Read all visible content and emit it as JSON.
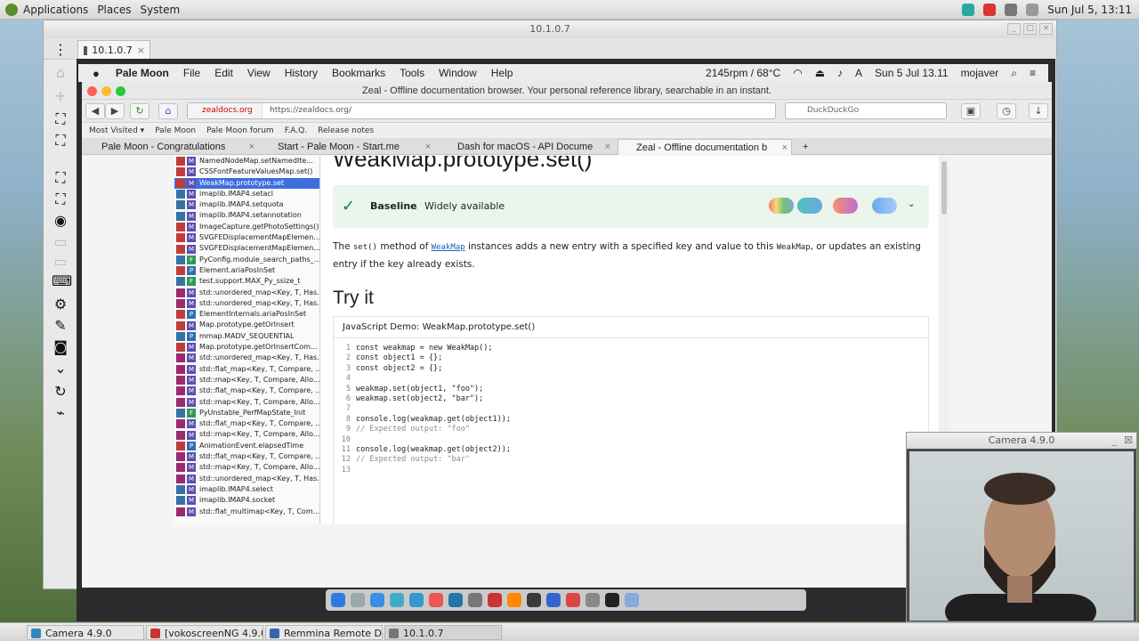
{
  "topbar": {
    "menus": [
      "Applications",
      "Places",
      "System"
    ],
    "clock": "Sun Jul  5, 13:11"
  },
  "remote_window": {
    "title": "10.1.0.7",
    "tab_label": "10.1.0.7"
  },
  "macbar": {
    "app_name": "Pale Moon",
    "menus": [
      "File",
      "Edit",
      "View",
      "History",
      "Bookmarks",
      "Tools",
      "Window",
      "Help"
    ],
    "fan": "2145rpm / 68°C",
    "datetime": "Sun 5 Jul  13.11",
    "user": "mojaver"
  },
  "browser": {
    "window_title": "Zeal - Offline documentation browser. Your personal reference library, searchable in an instant.",
    "site_label": "zealdocs.org",
    "url": "https://zealdocs.org/",
    "search_placeholder": "DuckDuckGo",
    "bookmarks": [
      "Most Visited ▾",
      "Pale Moon",
      "Pale Moon forum",
      "F.A.Q.",
      "Release notes"
    ],
    "tabs": [
      {
        "label": "Pale Moon - Congratulations"
      },
      {
        "label": "Start - Pale Moon - Start.me"
      },
      {
        "label": "Dash for macOS - API Docume"
      },
      {
        "label": "Zeal - Offline documentation b"
      }
    ],
    "new_tab": "+"
  },
  "sidebar": {
    "items": [
      {
        "label": "NamedNodeMap.setNamedIte...",
        "type": "M",
        "lang": "JS"
      },
      {
        "label": "CSSFontFeatureValuesMap.set()",
        "type": "M",
        "lang": "JS"
      },
      {
        "label": "WeakMap.prototype.set",
        "type": "M",
        "lang": "JS"
      },
      {
        "label": "imaplib.IMAP4.setacl",
        "type": "M",
        "lang": "PY"
      },
      {
        "label": "imaplib.IMAP4.setquota",
        "type": "M",
        "lang": "PY"
      },
      {
        "label": "imaplib.IMAP4.setannotation",
        "type": "M",
        "lang": "PY"
      },
      {
        "label": "ImageCapture.getPhotoSettings()",
        "type": "M",
        "lang": "JS"
      },
      {
        "label": "SVGFEDisplacementMapElemen...",
        "type": "M",
        "lang": "JS"
      },
      {
        "label": "SVGFEDisplacementMapElemen...",
        "type": "M",
        "lang": "JS"
      },
      {
        "label": "PyConfig.module_search_paths_...",
        "type": "F",
        "lang": "PY"
      },
      {
        "label": "Element.ariaPosInSet",
        "type": "P",
        "lang": "JS"
      },
      {
        "label": "test.support.MAX_Py_ssize_t",
        "type": "F",
        "lang": "PY"
      },
      {
        "label": "std::unordered_map<Key, T, Has...",
        "type": "M",
        "lang": "C"
      },
      {
        "label": "std::unordered_map<Key, T, Has...",
        "type": "M",
        "lang": "C"
      },
      {
        "label": "ElementInternals.ariaPosInSet",
        "type": "P",
        "lang": "JS"
      },
      {
        "label": "Map.prototype.getOrInsert",
        "type": "M",
        "lang": "JS"
      },
      {
        "label": "mmap.MADV_SEQUENTIAL",
        "type": "P",
        "lang": "PY"
      },
      {
        "label": "Map.prototype.getOrInsertCom...",
        "type": "M",
        "lang": "JS"
      },
      {
        "label": "std::unordered_map<Key, T, Has...",
        "type": "M",
        "lang": "C"
      },
      {
        "label": "std::flat_map<Key, T, Compare, ...",
        "type": "M",
        "lang": "C"
      },
      {
        "label": "std::map<Key, T, Compare, Allo...",
        "type": "M",
        "lang": "C"
      },
      {
        "label": "std::flat_map<Key, T, Compare, ...",
        "type": "M",
        "lang": "C"
      },
      {
        "label": "std::map<Key, T, Compare, Allo...",
        "type": "M",
        "lang": "C"
      },
      {
        "label": "PyUnstable_PerfMapState_Init",
        "type": "F",
        "lang": "PY"
      },
      {
        "label": "std::flat_map<Key, T, Compare, ...",
        "type": "M",
        "lang": "C"
      },
      {
        "label": "std::map<Key, T, Compare, Allo...",
        "type": "M",
        "lang": "C"
      },
      {
        "label": "AnimationEvent.elapsedTime",
        "type": "P",
        "lang": "JS"
      },
      {
        "label": "std::flat_map<Key, T, Compare, ...",
        "type": "M",
        "lang": "C"
      },
      {
        "label": "std::map<Key, T, Compare, Allo...",
        "type": "M",
        "lang": "C"
      },
      {
        "label": "std::unordered_map<Key, T, Has...",
        "type": "M",
        "lang": "C"
      },
      {
        "label": "imaplib.IMAP4.select",
        "type": "M",
        "lang": "PY"
      },
      {
        "label": "imaplib.IMAP4.socket",
        "type": "M",
        "lang": "PY"
      },
      {
        "label": "std::flat_multimap<Key, T, Com...",
        "type": "M",
        "lang": "C"
      }
    ],
    "selected_index": 2
  },
  "doc": {
    "title": "WeakMap.prototype.set()",
    "baseline_label": "Baseline",
    "baseline_value": "Widely available",
    "desc_the": "The",
    "desc_code1": "set()",
    "desc_mid": "method of",
    "desc_link": "WeakMap",
    "desc_rest": "instances adds a new entry with a specified key and value to this",
    "desc_code2": "WeakMap",
    "desc_end": ", or updates an existing entry if the key already exists.",
    "try_it": "Try it",
    "demo_title": "JavaScript Demo: WeakMap.prototype.set()",
    "code_lines": [
      "const weakmap = new WeakMap();",
      "const object1 = {};",
      "const object2 = {};",
      "",
      "weakmap.set(object1, \"foo\");",
      "weakmap.set(object2, \"bar\");",
      "",
      "console.log(weakmap.get(object1));",
      "// Expected output: \"foo\"",
      "",
      "console.log(weakmap.get(object2));",
      "// Expected output: \"bar\"",
      ""
    ]
  },
  "camera": {
    "title": "Camera 4.9.0"
  },
  "taskbar": {
    "items": [
      "Camera 4.9.0",
      "[vokoscreenNG 4.9.0]",
      "Remmina Remote D...",
      "10.1.0.7"
    ]
  },
  "colors": {
    "accent": "#3d6edd",
    "baseline_bg": "#eaf5ec",
    "check": "#1a7f37"
  }
}
